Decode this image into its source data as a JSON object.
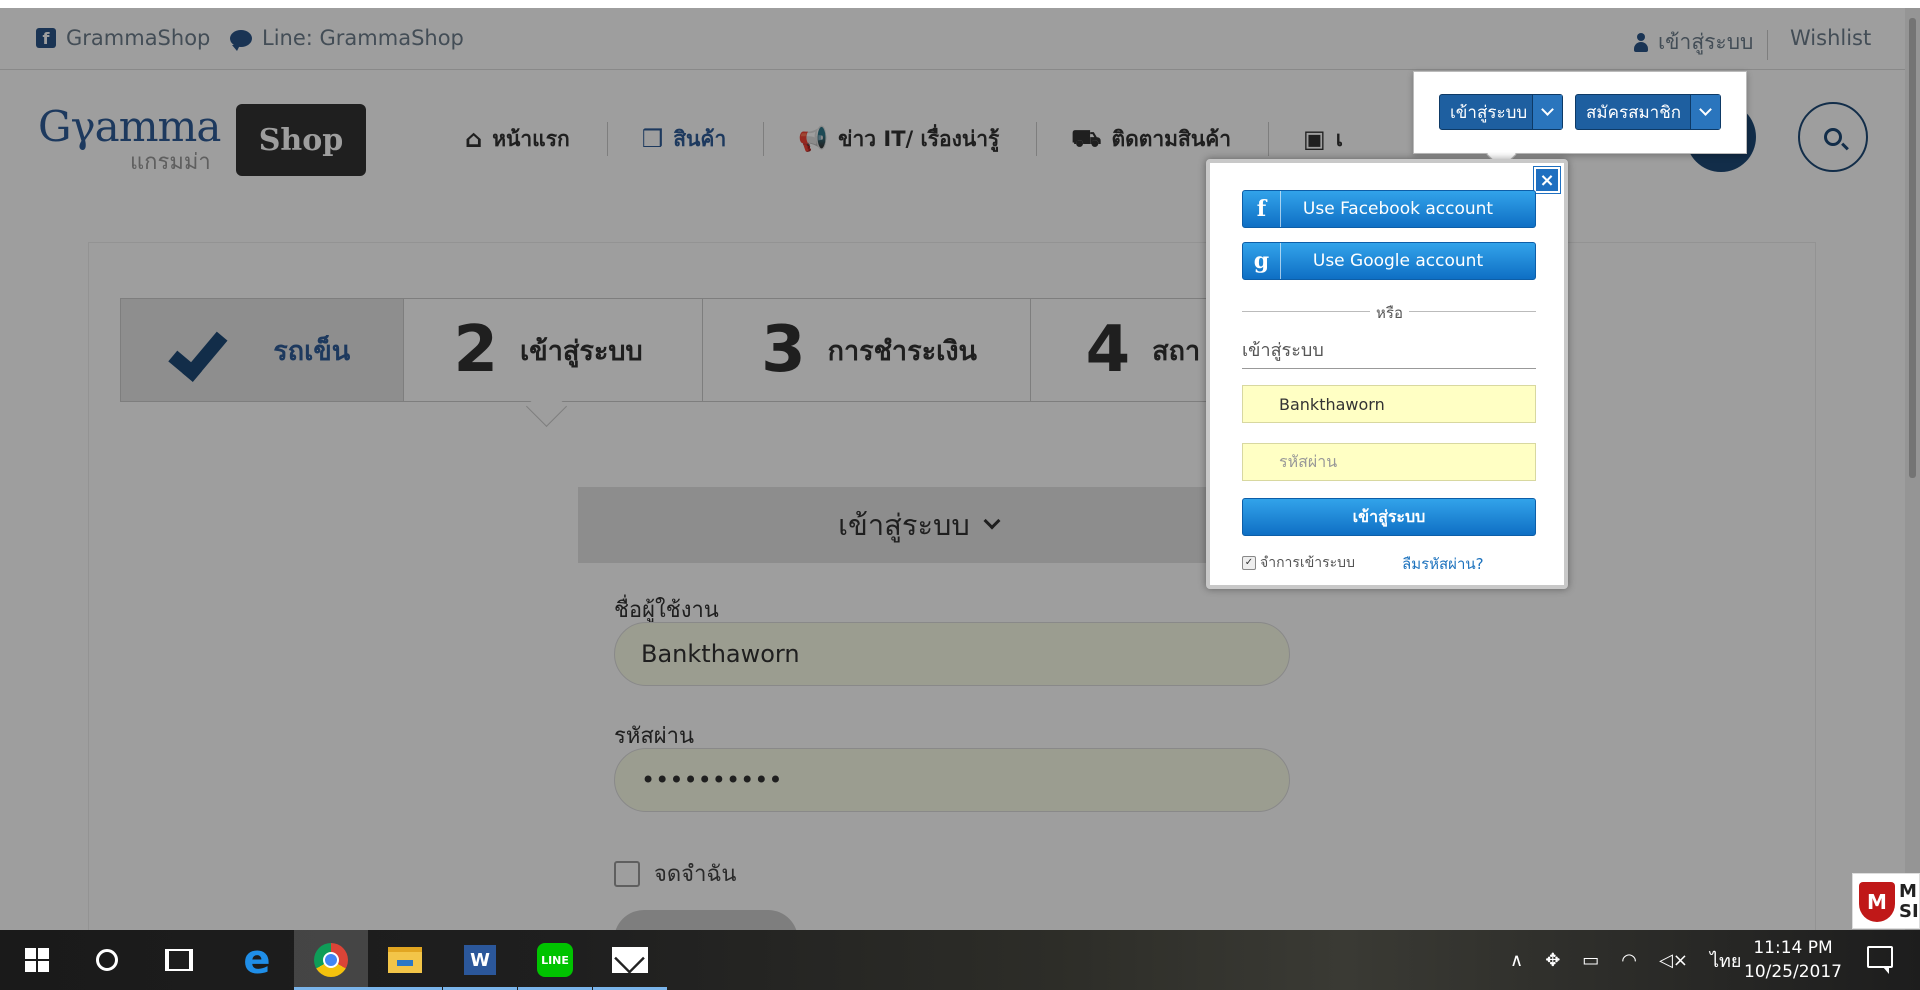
{
  "topbar": {
    "facebook_text": "GrammaShop",
    "line_text": "Line: GrammaShop",
    "login_text": "เข้าสู่ระบบ",
    "wishlist_text": "Wishlist"
  },
  "logo": {
    "main": "Gγamma",
    "sub": "แกรมม่า",
    "badge": "Shop"
  },
  "nav": {
    "items": [
      {
        "label": "หน้าแรก",
        "icon": "home-icon"
      },
      {
        "label": "สินค้า",
        "icon": "cubes-icon"
      },
      {
        "label": "ข่าว IT/ เรื่องน่ารู้",
        "icon": "bullhorn-icon"
      },
      {
        "label": "ติดตามสินค้า",
        "icon": "truck-icon"
      },
      {
        "label": "เ",
        "icon": "contact-card-icon"
      }
    ]
  },
  "steps": {
    "s1_label": "รถเข็น",
    "s2_num": "2",
    "s2_label": "เข้าสู่ระบบ",
    "s3_num": "3",
    "s3_label": "การชำระเงิน",
    "s4_num": "4",
    "s4_label": "สถา"
  },
  "login_form": {
    "panel_title": "เข้าสู่ระบบ",
    "username_label": "ชื่อผู้ใช้งาน",
    "username_value": "Bankthaworn",
    "password_label": "รหัสผ่าน",
    "password_value": "••••••••••",
    "remember_label": "จดจำฉัน"
  },
  "mini_menu": {
    "login_btn": "เข้าสู่ระบบ",
    "register_btn": "สมัครสมาชิก"
  },
  "popup": {
    "close": "×",
    "facebook_btn": "Use Facebook account",
    "facebook_glyph": "f",
    "google_btn": "Use Google account",
    "google_glyph": "g",
    "or_text": "หรือ",
    "section_title": "เข้าสู่ระบบ",
    "username_value": "Bankthaworn",
    "password_placeholder": "รหัสผ่าน",
    "submit": "เข้าสู่ระบบ",
    "remember": "จำการเข้าระบบ",
    "forgot": "ลืมรหัสผ่าน?"
  },
  "mcafee": {
    "text": "M\nSI"
  },
  "taskbar": {
    "tray_language": "ไทย",
    "time": "11:14 PM",
    "date": "10/25/2017"
  },
  "colors": {
    "brand_blue": "#1d4a77",
    "button_blue": "#1e6fc0",
    "input_yellow": "#ffffc4"
  }
}
